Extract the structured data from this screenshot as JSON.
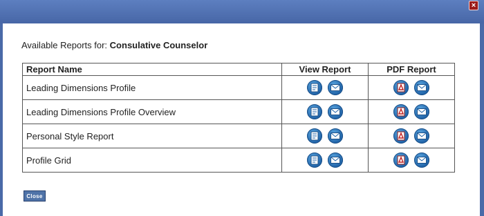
{
  "window": {
    "close_symbol": "×"
  },
  "heading": {
    "prefix": "Available Reports for:",
    "subject": "Consulative Counselor"
  },
  "table": {
    "headers": [
      "Report Name",
      "View Report",
      "PDF Report"
    ],
    "rows": [
      {
        "name": "Leading Dimensions Profile"
      },
      {
        "name": "Leading Dimensions Profile Overview"
      },
      {
        "name": "Personal Style Report"
      },
      {
        "name": "Profile Grid"
      }
    ]
  },
  "icons": {
    "view": "document-icon",
    "pdf": "pdf-icon",
    "email": "email-icon"
  },
  "footer": {
    "close_label": "Close"
  },
  "colors": {
    "title_bar": "#4a6aa8",
    "icon_blue": "#1f62a7",
    "close_x": "#9c1b1b"
  }
}
